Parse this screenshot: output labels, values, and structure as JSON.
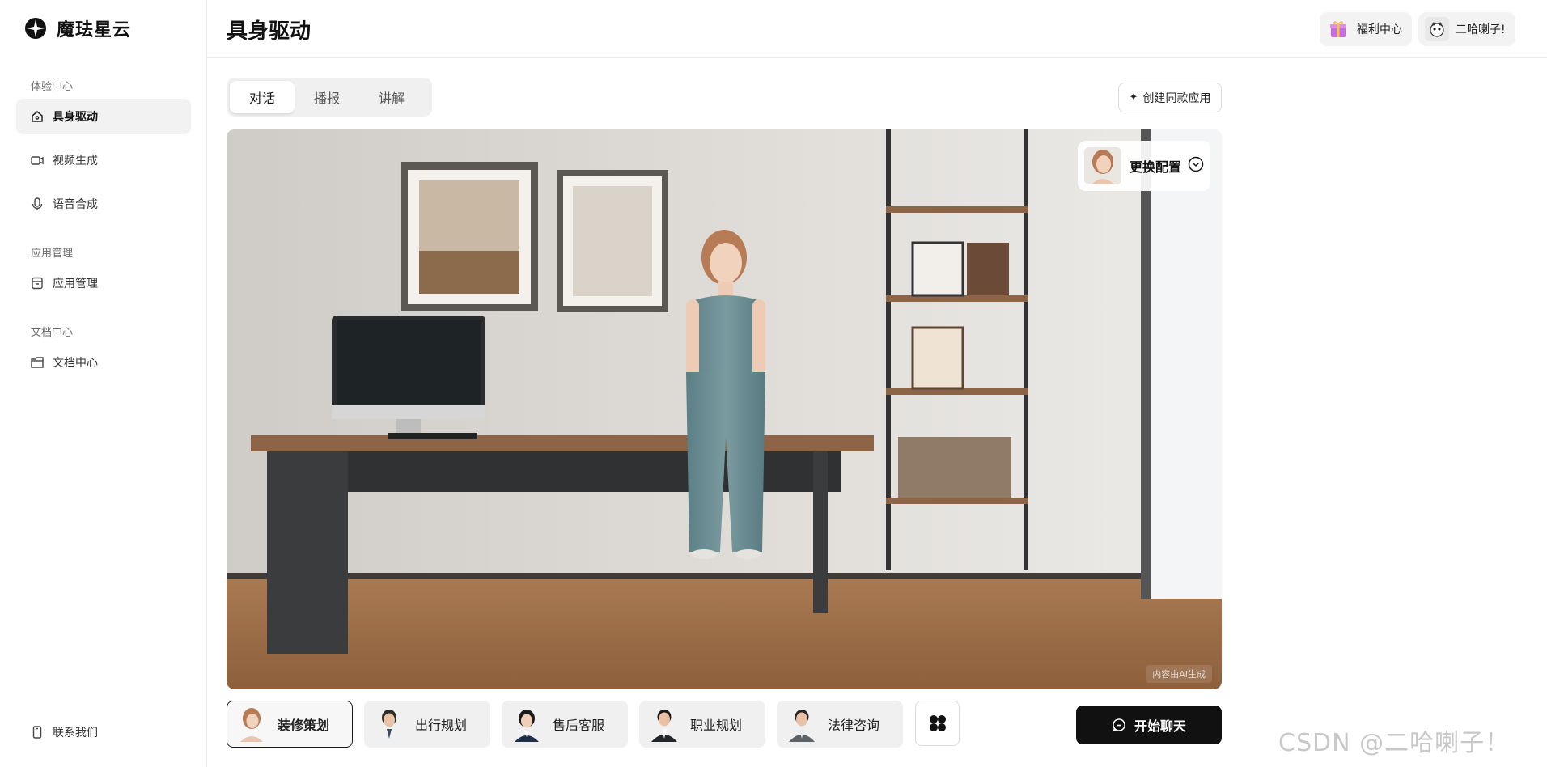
{
  "app": {
    "name": "魔珐星云"
  },
  "sidebar": {
    "groups": [
      {
        "title": "体验中心",
        "items": [
          {
            "label": "具身驱动",
            "icon": "home-icon",
            "active": true
          },
          {
            "label": "视频生成",
            "icon": "video-icon"
          },
          {
            "label": "语音合成",
            "icon": "microphone-icon"
          }
        ]
      },
      {
        "title": "应用管理",
        "items": [
          {
            "label": "应用管理",
            "icon": "box-icon"
          }
        ]
      },
      {
        "title": "文档中心",
        "items": [
          {
            "label": "文档中心",
            "icon": "folder-icon"
          }
        ]
      }
    ],
    "footer": {
      "label": "联系我们",
      "icon": "phone-icon"
    }
  },
  "header": {
    "title": "具身驱动",
    "welfare_label": "福利中心",
    "user_name": "二哈喇子!"
  },
  "tabs": [
    {
      "label": "对话",
      "active": true
    },
    {
      "label": "播报"
    },
    {
      "label": "讲解"
    }
  ],
  "create_button": {
    "label": "创建同款应用"
  },
  "stage": {
    "config_label": "更换配置",
    "ai_notice": "内容由AI生成"
  },
  "scenarios": [
    {
      "label": "装修策划",
      "active": true
    },
    {
      "label": "出行规划"
    },
    {
      "label": "售后客服"
    },
    {
      "label": "职业规划"
    },
    {
      "label": "法律咨询"
    }
  ],
  "start_button": {
    "label": "开始聊天"
  },
  "watermark": "CSDN @二哈喇子！",
  "colors": {
    "primary": "#111111",
    "active_bg": "#f2f2f2",
    "card_bg": "#f0f0f0"
  }
}
